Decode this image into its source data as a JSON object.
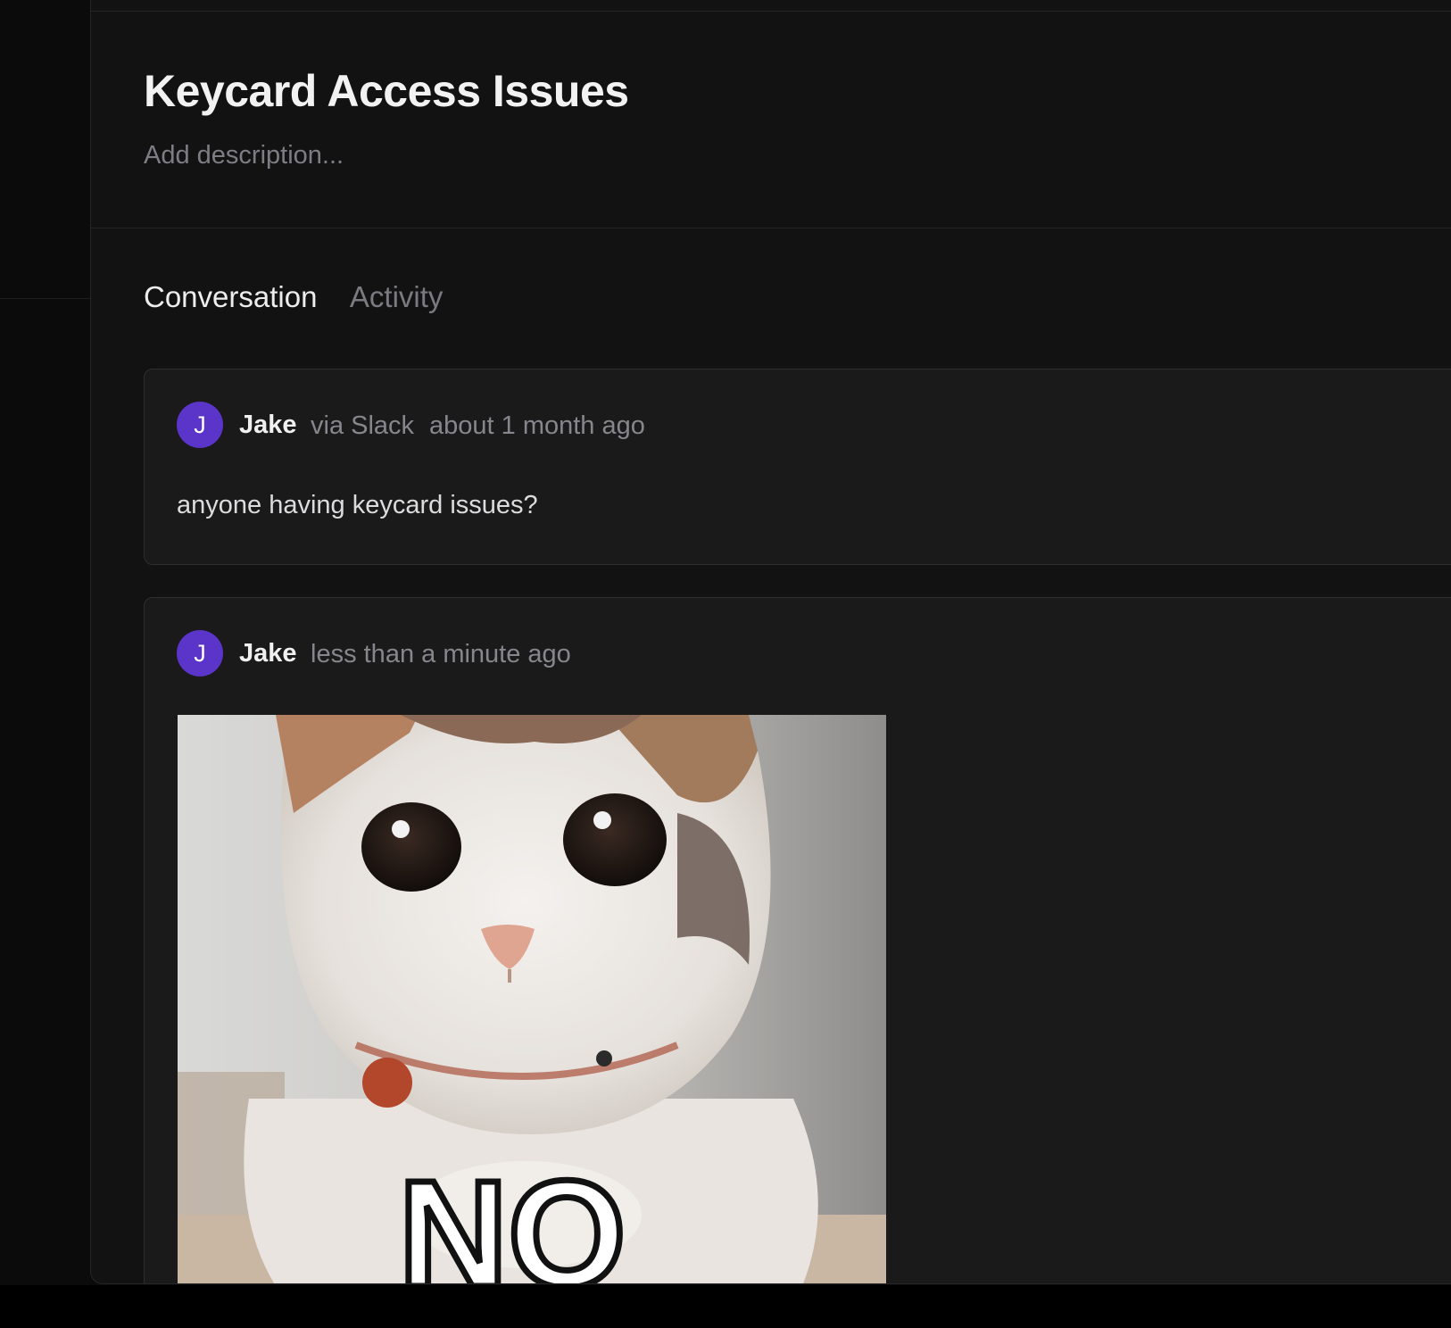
{
  "issue": {
    "title": "Keycard Access Issues",
    "description_placeholder": "Add description..."
  },
  "tabs": [
    {
      "label": "Conversation",
      "active": true
    },
    {
      "label": "Activity",
      "active": false
    }
  ],
  "messages": [
    {
      "avatar_initial": "J",
      "author": "Jake",
      "source": "via Slack",
      "timestamp": "about 1 month ago",
      "text": "anyone having keycard issues?"
    },
    {
      "avatar_initial": "J",
      "author": "Jake",
      "timestamp": "less than a minute ago",
      "image_caption": "NO"
    }
  ],
  "colors": {
    "background": "#121213",
    "card": "#1a1a1b",
    "avatar": "#5b34c9",
    "muted_text": "#86868c"
  }
}
